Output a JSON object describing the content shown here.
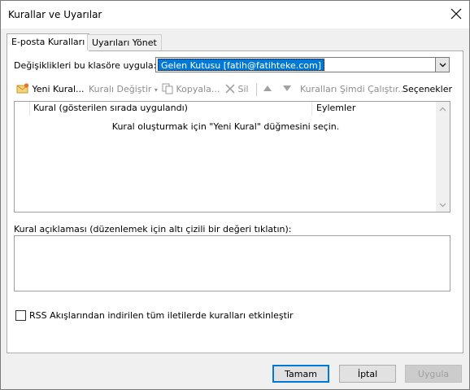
{
  "window": {
    "title": "Kurallar ve Uyarılar"
  },
  "tabs": [
    {
      "label": "E-posta Kuralları",
      "active": true
    },
    {
      "label": "Uyarıları Yönet",
      "active": false
    }
  ],
  "folder": {
    "label": "Değişiklikleri bu klasöre uygula:",
    "value": "Gelen Kutusu [fatih@fatihteke.com]"
  },
  "toolbar": {
    "new_rule": "Yeni Kural...",
    "change_rule": "Kuralı Değiştir",
    "copy": "Kopyala...",
    "delete": "Sil",
    "run_now": "Kuralları Şimdi Çalıştır...",
    "options": "Seçenekler"
  },
  "rules_table": {
    "columns": [
      "Kural (gösterilen sırada uygulandı)",
      "Eylemler"
    ],
    "empty_message": "Kural oluşturmak için \"Yeni Kural\" düğmesini seçin."
  },
  "description": {
    "label": "Kural açıklaması (düzenlemek için altı çizili bir değeri tıklatın):"
  },
  "rss": {
    "label": "RSS Akışlarından indirilen tüm iletilerde kuralları etkinleştir",
    "checked": false
  },
  "buttons": {
    "ok": "Tamam",
    "cancel": "İptal",
    "apply": "Uygula"
  },
  "colors": {
    "accent": "#0078d7",
    "disabled_text": "#8d8d8d"
  }
}
